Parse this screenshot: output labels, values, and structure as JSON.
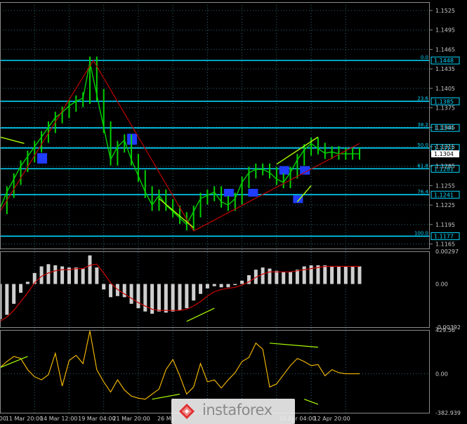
{
  "chart_data": {
    "type": "line",
    "title": "",
    "price_panel": {
      "ylim": [
        1.1158,
        1.1538
      ],
      "tick_labels": [
        {
          "value": 1.1525,
          "label": "1.1525"
        },
        {
          "value": 1.1495,
          "label": "1.1495"
        },
        {
          "value": 1.1465,
          "label": "1.1465"
        },
        {
          "value": 1.1435,
          "label": "1.1435"
        },
        {
          "value": 1.1405,
          "label": "1.1405"
        },
        {
          "value": 1.1375,
          "label": "1.1375"
        },
        {
          "value": 1.1345,
          "label": "1.1345"
        },
        {
          "value": 1.1315,
          "label": "1.1315"
        },
        {
          "value": 1.1285,
          "label": "1.1285"
        },
        {
          "value": 1.1255,
          "label": "1.1255"
        },
        {
          "value": 1.1225,
          "label": "1.1225"
        },
        {
          "value": 1.1195,
          "label": "1.1195"
        },
        {
          "value": 1.1165,
          "label": "1.1165"
        }
      ],
      "horizontal_levels": [
        {
          "value": 1.1448,
          "label": "1.1448",
          "fib": "0.0"
        },
        {
          "value": 1.1385,
          "label": "1.1385",
          "fib": "23.6"
        },
        {
          "value": 1.1344,
          "label": "1.1344",
          "fib": "38.2"
        },
        {
          "value": 1.1313,
          "label": "1.1313",
          "fib": "50.0"
        },
        {
          "value": 1.1281,
          "label": "1.1281",
          "fib": "61.8"
        },
        {
          "value": 1.1241,
          "label": "1.1241",
          "fib": "76.4"
        },
        {
          "value": 1.1177,
          "label": "1.1177",
          "fib": "100.0"
        }
      ],
      "current_price": {
        "value": 1.1304,
        "label": "1.1304"
      },
      "x": [
        0,
        2,
        4,
        6,
        8,
        10,
        12,
        14,
        16,
        18,
        20,
        22,
        24,
        26,
        28,
        30,
        32,
        34,
        36,
        38,
        40,
        42,
        44,
        46,
        48,
        50,
        52,
        54,
        56,
        58,
        60,
        62,
        64,
        66,
        68,
        70,
        72,
        74,
        76,
        78,
        80,
        82,
        84,
        86,
        88,
        90,
        92,
        94,
        96,
        98,
        100,
        102,
        104
      ],
      "close": [
        1.122,
        1.1245,
        1.1265,
        1.1285,
        1.13,
        1.1315,
        1.133,
        1.1345,
        1.136,
        1.1368,
        1.1378,
        1.1385,
        1.139,
        1.1445,
        1.1395,
        1.1345,
        1.1295,
        1.1315,
        1.1325,
        1.1295,
        1.127,
        1.1245,
        1.1225,
        1.124,
        1.1225,
        1.1215,
        1.1205,
        1.1195,
        1.1215,
        1.1235,
        1.124,
        1.1245,
        1.123,
        1.1225,
        1.1235,
        1.126,
        1.1275,
        1.128,
        1.128,
        1.1275,
        1.1265,
        1.126,
        1.1275,
        1.1295,
        1.131,
        1.132,
        1.1312,
        1.1305,
        1.1307,
        1.1304,
        1.1304,
        1.1304,
        1.1304
      ]
    },
    "macd_panel": {
      "ylim": [
        -0.00392,
        0.00297
      ],
      "tick_labels": [
        {
          "value": 0.00297,
          "label": "0.00297"
        },
        {
          "value": 0.0,
          "label": "0.00"
        },
        {
          "value": -0.00392,
          "label": "-0.00392"
        }
      ],
      "x": [
        0,
        2,
        4,
        6,
        8,
        10,
        12,
        14,
        16,
        18,
        20,
        22,
        24,
        26,
        28,
        30,
        32,
        34,
        36,
        38,
        40,
        42,
        44,
        46,
        48,
        50,
        52,
        54,
        56,
        58,
        60,
        62,
        64,
        66,
        68,
        70,
        72,
        74,
        76,
        78,
        80,
        82,
        84,
        86,
        88,
        90,
        92,
        94,
        96,
        98,
        100,
        102,
        104
      ],
      "histogram": [
        -0.0032,
        -0.0028,
        -0.0018,
        -0.0008,
        0.0002,
        0.001,
        0.0016,
        0.0018,
        0.0017,
        0.0016,
        0.0015,
        0.0015,
        0.0014,
        0.0026,
        0.0015,
        -0.0005,
        -0.0012,
        -0.0011,
        -0.0012,
        -0.0018,
        -0.0022,
        -0.0025,
        -0.0027,
        -0.0025,
        -0.0026,
        -0.0025,
        -0.0024,
        -0.0022,
        -0.0015,
        -0.0009,
        -0.0004,
        -0.0002,
        -0.0003,
        -0.0003,
        -0.0001,
        0.0003,
        0.0008,
        0.0013,
        0.0015,
        0.0014,
        0.0012,
        0.0011,
        0.0011,
        0.0013,
        0.0016,
        0.0017,
        0.0017,
        0.0017,
        0.0016,
        0.0016,
        0.0016,
        0.0016,
        0.0016
      ],
      "signal": [
        -0.0034,
        -0.003,
        -0.0024,
        -0.0016,
        -0.0008,
        0.0001,
        0.0007,
        0.001,
        0.0012,
        0.0013,
        0.0013,
        0.0014,
        0.0014,
        0.0017,
        0.0018,
        0.001,
        0.0001,
        -0.0005,
        -0.0009,
        -0.0013,
        -0.0017,
        -0.002,
        -0.0023,
        -0.0024,
        -0.0024,
        -0.0024,
        -0.0024,
        -0.0023,
        -0.002,
        -0.0016,
        -0.0011,
        -0.0007,
        -0.0005,
        -0.0004,
        -0.0003,
        -0.0001,
        0.0002,
        0.0006,
        0.0009,
        0.0011,
        0.0011,
        0.0011,
        0.0011,
        0.0012,
        0.0013,
        0.0014,
        0.0015,
        0.0016,
        0.0016,
        0.0016,
        0.0016,
        0.0016,
        0.0016
      ]
    },
    "cci_panel": {
      "ylim": [
        -382.939,
        429.56
      ],
      "tick_labels": [
        {
          "value": 429.56,
          "label": "429.56"
        },
        {
          "value": 0.0,
          "label": "0.00"
        },
        {
          "value": -382.939,
          "label": "-382.939"
        }
      ],
      "x": [
        0,
        2,
        4,
        6,
        8,
        10,
        12,
        14,
        16,
        18,
        20,
        22,
        24,
        26,
        28,
        30,
        32,
        34,
        36,
        38,
        40,
        42,
        44,
        46,
        48,
        50,
        52,
        54,
        56,
        58,
        60,
        62,
        64,
        66,
        68,
        70,
        72,
        74,
        76,
        78,
        80,
        82,
        84,
        86,
        88,
        90,
        92,
        94,
        96,
        98,
        100,
        102,
        104
      ],
      "values": [
        60,
        120,
        170,
        150,
        40,
        -30,
        -60,
        -10,
        200,
        -120,
        130,
        180,
        100,
        420,
        40,
        -80,
        -180,
        -60,
        -160,
        -220,
        -240,
        -250,
        -200,
        -150,
        40,
        140,
        -20,
        -200,
        -130,
        100,
        -80,
        -60,
        -140,
        -60,
        10,
        120,
        160,
        300,
        240,
        -130,
        -100,
        -10,
        80,
        150,
        120,
        80,
        90,
        -20,
        40,
        10,
        0,
        0,
        0
      ]
    },
    "x_axis": {
      "tick_labels": [
        {
          "x": 0,
          "label": "0:00"
        },
        {
          "x": 7,
          "label": "11 Mar 20:00"
        },
        {
          "x": 17,
          "label": "14 Mar 12:00"
        },
        {
          "x": 28,
          "label": "19 Mar 04:00"
        },
        {
          "x": 38,
          "label": "21 Mar 20:00"
        },
        {
          "x": 48,
          "label": "26 Ma"
        },
        {
          "x": 86,
          "label": "10 Apr 04:00"
        },
        {
          "x": 96,
          "label": "12 Apr 20:00"
        }
      ]
    },
    "colors": {
      "background": "#000000",
      "grid": "#2a6a7a",
      "levels": "#00d8ff",
      "price": "#00d000",
      "zigzag": "#c00000",
      "trendlines": "#aaff00",
      "boxes": "#1f3cff",
      "histogram": "#cfcfcf",
      "signal": "#d00000",
      "cci": "#ffc000",
      "axis_text": "#c8c8c8"
    }
  },
  "watermark": {
    "text": "instaforex"
  }
}
